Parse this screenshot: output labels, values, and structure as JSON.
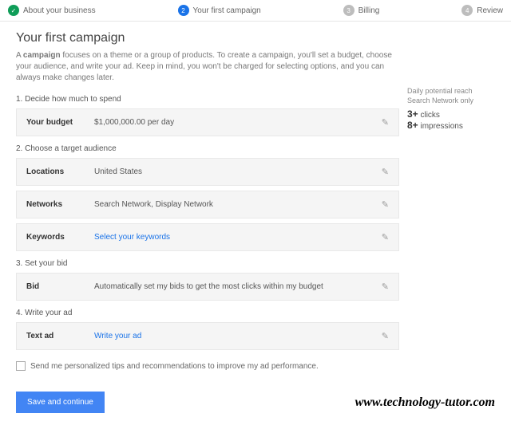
{
  "stepper": {
    "steps": [
      {
        "label": "About your business",
        "state": "done"
      },
      {
        "label": "Your first campaign",
        "state": "active",
        "num": "2"
      },
      {
        "label": "Billing",
        "state": "todo",
        "num": "3"
      },
      {
        "label": "Review",
        "state": "todo",
        "num": "4"
      }
    ]
  },
  "page": {
    "title": "Your first campaign",
    "intro_prefix": "A ",
    "intro_bold": "campaign",
    "intro_rest": " focuses on a theme or a group of products. To create a campaign, you'll set a budget, choose your audience, and write your ad. Keep in mind, you won't be charged for selecting options, and you can always make changes later."
  },
  "sections": {
    "s1": "1. Decide how much to spend",
    "s2": "2. Choose a target audience",
    "s3": "3. Set your bid",
    "s4": "4. Write your ad"
  },
  "cards": {
    "budget": {
      "label": "Your budget",
      "value": "$1,000,000.00 per day"
    },
    "locations": {
      "label": "Locations",
      "value": "United States"
    },
    "networks": {
      "label": "Networks",
      "value": "Search Network, Display Network"
    },
    "keywords": {
      "label": "Keywords",
      "value": "Select your keywords"
    },
    "bid": {
      "label": "Bid",
      "value": "Automatically set my bids to get the most clicks within my budget"
    },
    "textad": {
      "label": "Text ad",
      "value": "Write your ad"
    }
  },
  "sidebar": {
    "title1": "Daily potential reach",
    "title2": "Search Network only",
    "clicks_num": "3+",
    "clicks_label": " clicks",
    "impr_num": "8+",
    "impr_label": " impressions"
  },
  "tips": "Send me personalized tips and recommendations to improve my ad performance.",
  "save": "Save and continue",
  "watermark": "www.technology-tutor.com"
}
